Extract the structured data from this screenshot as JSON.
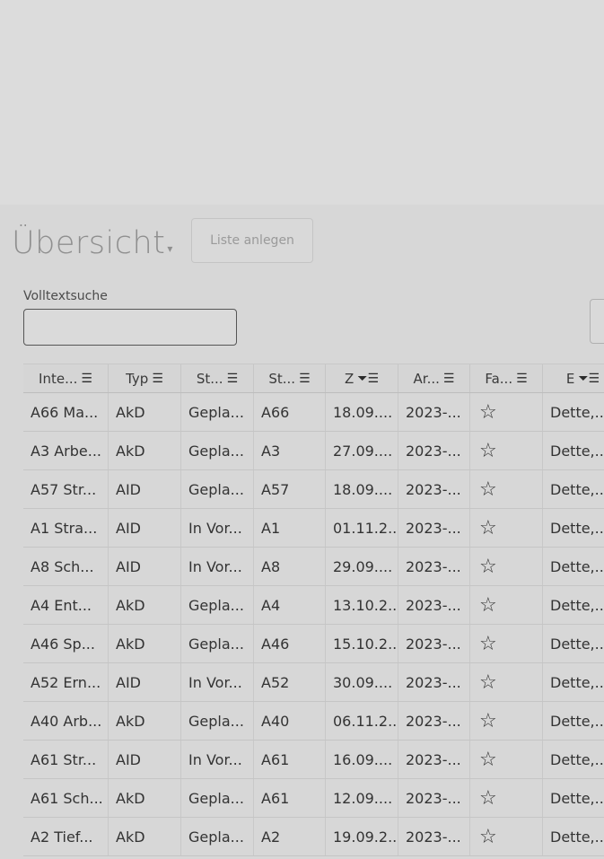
{
  "header": {
    "title": "Übersicht",
    "caret": "▾",
    "create_list_label": "Liste anlegen"
  },
  "search": {
    "label": "Volltextsuche",
    "value": ""
  },
  "table": {
    "columns": [
      {
        "label": "Inte...",
        "icons": "☰"
      },
      {
        "label": "Typ",
        "icons": "☰"
      },
      {
        "label": "St...",
        "icons": "☰"
      },
      {
        "label": "St...",
        "icons": "☰"
      },
      {
        "label": "Z",
        "icons": "⏷☰"
      },
      {
        "label": "Ar...",
        "icons": "☰"
      },
      {
        "label": "Fa...",
        "icons": "☰"
      },
      {
        "label": "E",
        "icons": "⏷☰"
      }
    ],
    "rows": [
      [
        "A66 Ma...",
        "AkD",
        "Gepla...",
        "A66",
        "18.09....",
        "2023-...",
        "☆",
        "Dette,..."
      ],
      [
        "A3 Arbe...",
        "AkD",
        "Gepla...",
        "A3",
        "27.09....",
        "2023-...",
        "☆",
        "Dette,..."
      ],
      [
        "A57 Str...",
        "AID",
        "Gepla...",
        "A57",
        "18.09....",
        "2023-...",
        "☆",
        "Dette,..."
      ],
      [
        "A1 Stra...",
        "AID",
        "In Vor...",
        "A1",
        "01.11.2...",
        "2023-...",
        "☆",
        "Dette,..."
      ],
      [
        "A8 Sch...",
        "AID",
        "In Vor...",
        "A8",
        "29.09....",
        "2023-...",
        "☆",
        "Dette,..."
      ],
      [
        "A4 Ent...",
        "AkD",
        "Gepla...",
        "A4",
        "13.10.2...",
        "2023-...",
        "☆",
        "Dette,..."
      ],
      [
        "A46 Sp...",
        "AkD",
        "Gepla...",
        "A46",
        "15.10.2...",
        "2023-...",
        "☆",
        "Dette,..."
      ],
      [
        "A52 Ern...",
        "AID",
        "In Vor...",
        "A52",
        "30.09....",
        "2023-...",
        "☆",
        "Dette,..."
      ],
      [
        "A40 Arb...",
        "AkD",
        "Gepla...",
        "A40",
        "06.11.2...",
        "2023-...",
        "☆",
        "Dette,..."
      ],
      [
        "A61 Str...",
        "AID",
        "In Vor...",
        "A61",
        "16.09....",
        "2023-...",
        "☆",
        "Dette,..."
      ],
      [
        "A61 Sch...",
        "AkD",
        "Gepla...",
        "A61",
        "12.09....",
        "2023-...",
        "☆",
        "Dette,..."
      ],
      [
        "A2 Tief...",
        "AkD",
        "Gepla...",
        "A2",
        "19.09.2...",
        "2023-...",
        "☆",
        "Dette,..."
      ]
    ]
  }
}
